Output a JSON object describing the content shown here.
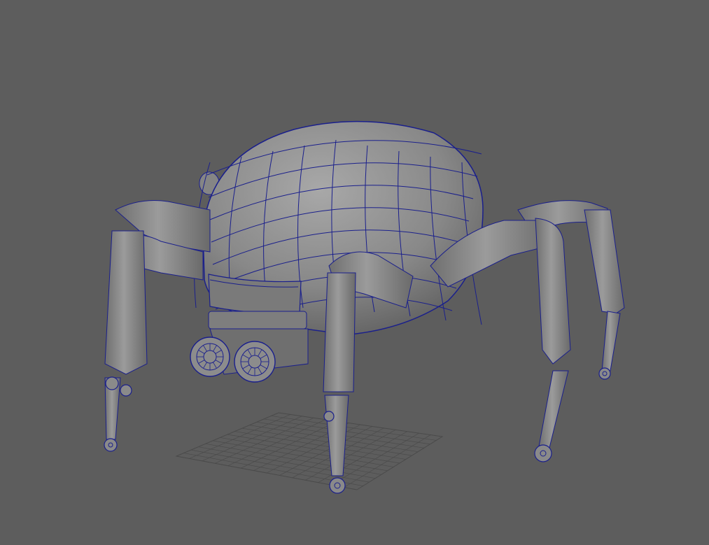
{
  "viewport": {
    "background": "#5d5d5d",
    "wireframe_color": "#1a1f8c",
    "surface_color": "#8a8a8a",
    "grid_color": "#4a4a4a"
  },
  "scene": {
    "model_icon": "spider-robot-mesh",
    "display_mode": "wireframe-on-shaded",
    "ground_grid_visible": true
  }
}
